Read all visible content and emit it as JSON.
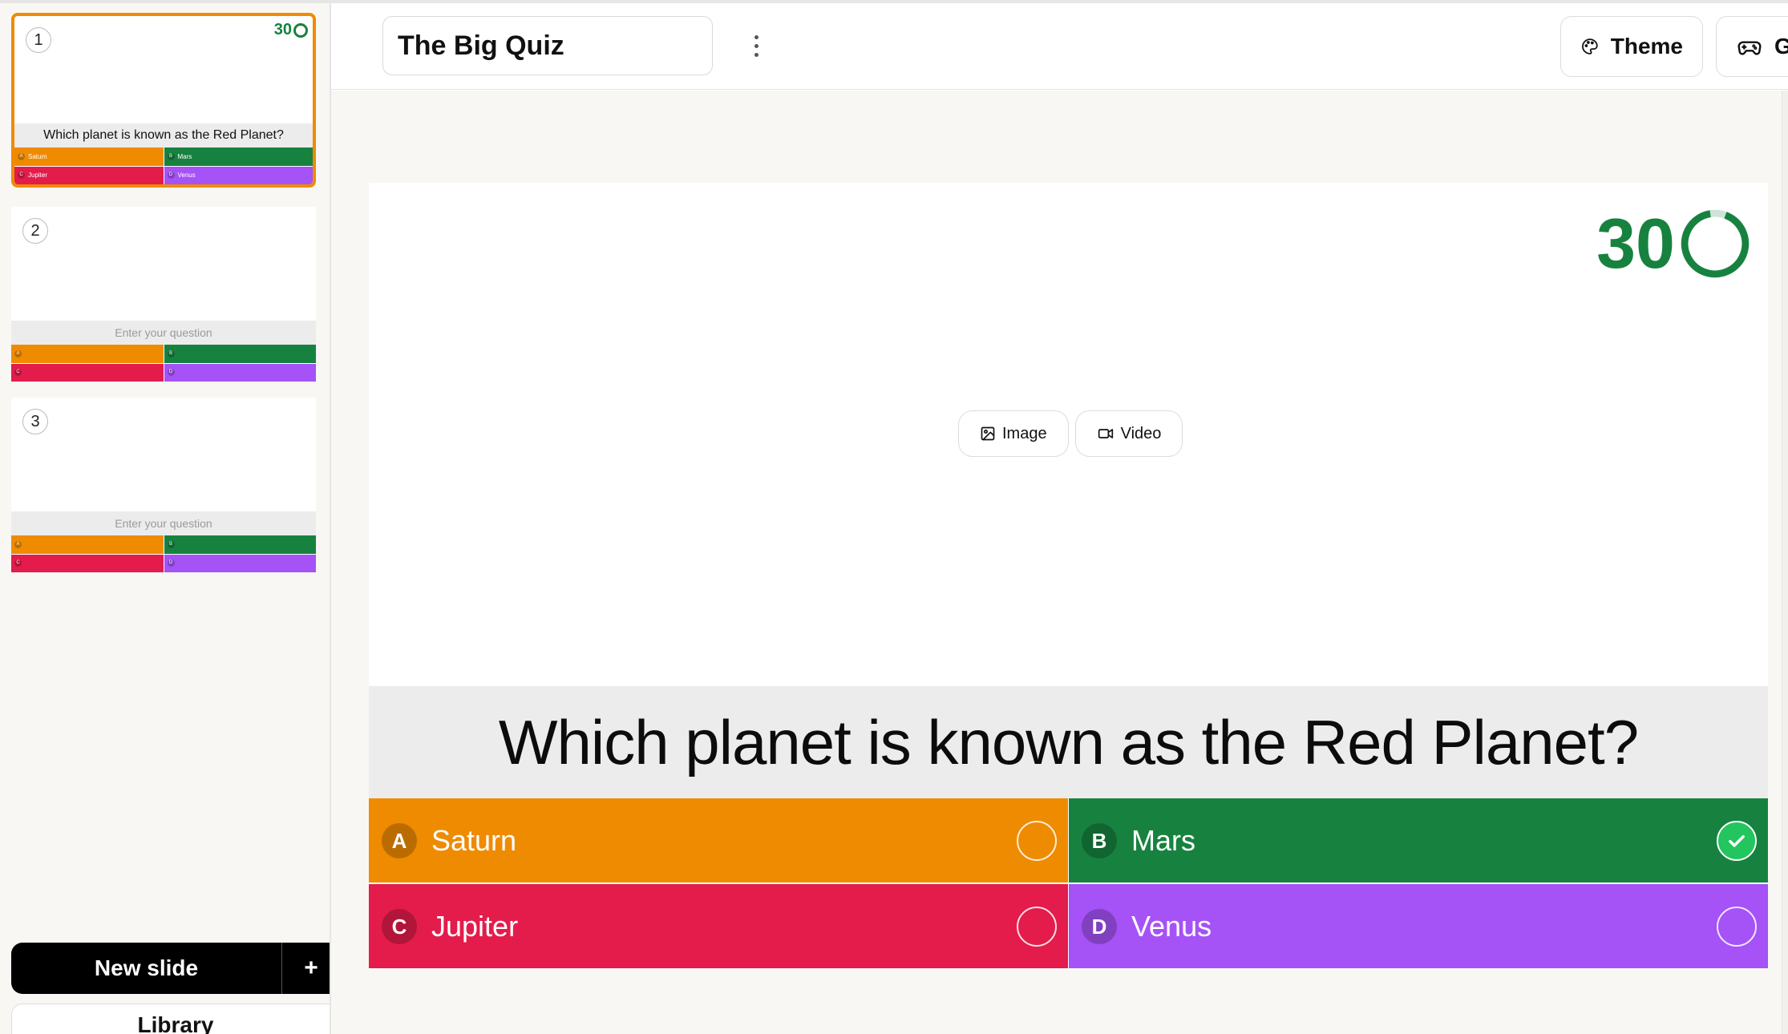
{
  "header": {
    "title_value": "The Big Quiz",
    "theme_label": "Theme",
    "game_label": "Ga"
  },
  "sidebar": {
    "slides": [
      {
        "number": "1",
        "timer": "30",
        "question": "Which planet is known as the Red Planet?",
        "answers": [
          {
            "letter": "A",
            "text": "Saturn"
          },
          {
            "letter": "B",
            "text": "Mars"
          },
          {
            "letter": "C",
            "text": "Jupiter"
          },
          {
            "letter": "D",
            "text": "Venus"
          }
        ]
      },
      {
        "number": "2",
        "question_placeholder": "Enter your question",
        "answers": [
          {
            "letter": "A"
          },
          {
            "letter": "B"
          },
          {
            "letter": "C"
          },
          {
            "letter": "D"
          }
        ]
      },
      {
        "number": "3",
        "question_placeholder": "Enter your question",
        "answers": [
          {
            "letter": "A"
          },
          {
            "letter": "B"
          },
          {
            "letter": "C"
          },
          {
            "letter": "D"
          }
        ]
      }
    ],
    "new_slide_label": "New slide",
    "new_slide_plus": "+",
    "library_label": "Library"
  },
  "editor": {
    "timer": "30",
    "media": {
      "image_label": "Image",
      "video_label": "Video"
    },
    "question": "Which planet is known as the Red Planet?",
    "answers": [
      {
        "letter": "A",
        "text": "Saturn",
        "correct": false
      },
      {
        "letter": "B",
        "text": "Mars",
        "correct": true
      },
      {
        "letter": "C",
        "text": "Jupiter",
        "correct": false
      },
      {
        "letter": "D",
        "text": "Venus",
        "correct": false
      }
    ]
  },
  "colors": {
    "answer_a": "#ef8b00",
    "answer_b": "#17823f",
    "answer_c": "#e31c4b",
    "answer_d": "#a552f7",
    "selected_outline": "#ef8b00",
    "timer": "#17823f",
    "correct_check": "#22c55e"
  }
}
